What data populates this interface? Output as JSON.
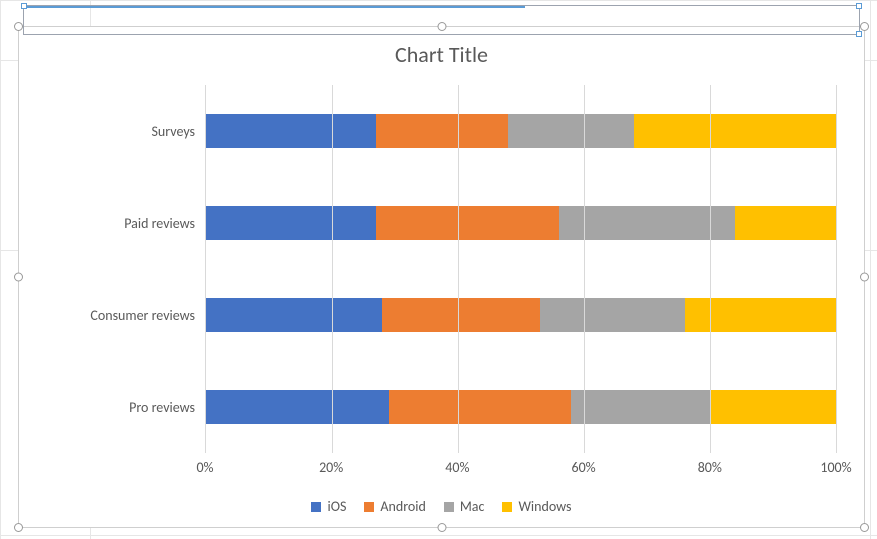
{
  "chart_data": {
    "type": "bar",
    "orientation": "horizontal-stacked-100",
    "title": "Chart Title",
    "xlabel": "",
    "ylabel": "",
    "xlim": [
      0,
      100
    ],
    "x_ticks": [
      "0%",
      "20%",
      "40%",
      "60%",
      "80%",
      "100%"
    ],
    "categories": [
      "Surveys",
      "Paid reviews",
      "Consumer reviews",
      "Pro reviews"
    ],
    "series": [
      {
        "name": "iOS",
        "color": "#4472C4",
        "values": [
          27,
          27,
          28,
          29
        ]
      },
      {
        "name": "Android",
        "color": "#ED7D31",
        "values": [
          21,
          29,
          25,
          29
        ]
      },
      {
        "name": "Mac",
        "color": "#A5A5A5",
        "values": [
          20,
          28,
          23,
          22
        ]
      },
      {
        "name": "Windows",
        "color": "#FFC000",
        "values": [
          32,
          16,
          24,
          20
        ]
      }
    ],
    "note": "values are percent of each category (rows sum to 100); categories listed top-to-bottom as rendered"
  }
}
